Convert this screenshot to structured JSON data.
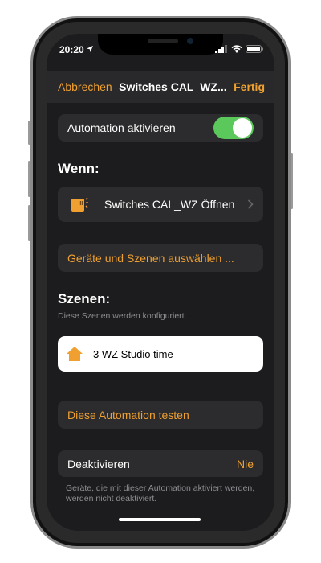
{
  "status": {
    "time": "20:20"
  },
  "nav": {
    "cancel": "Abbrechen",
    "title": "Switches CAL_WZ...",
    "done": "Fertig"
  },
  "enable": {
    "label": "Automation aktivieren",
    "on": true
  },
  "when": {
    "heading": "Wenn:",
    "trigger": "Switches CAL_WZ Öffnen"
  },
  "select": {
    "label": "Geräte und Szenen auswählen ..."
  },
  "scenes": {
    "heading": "Szenen:",
    "subtitle": "Diese Szenen werden konfiguriert.",
    "items": [
      {
        "name": "3 WZ Studio time"
      }
    ]
  },
  "test": {
    "label": "Diese Automation testen"
  },
  "deactivate": {
    "label": "Deaktivieren",
    "value": "Nie",
    "footer": "Geräte, die mit dieser Automation aktiviert werden, werden nicht deaktiviert."
  },
  "colors": {
    "accent": "#f0a030",
    "toggle": "#5ac85a",
    "background": "#1c1c1e",
    "cell": "#2c2c2e"
  }
}
